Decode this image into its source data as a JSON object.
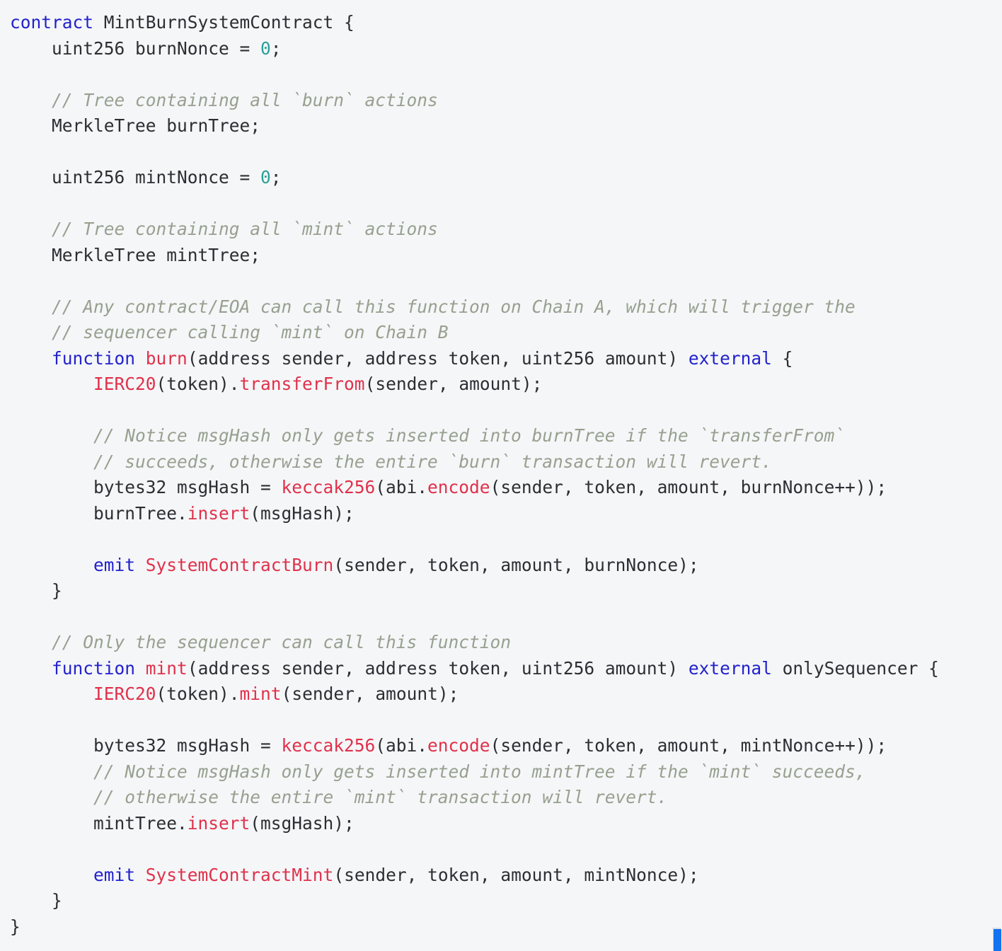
{
  "editor": {
    "language": "solidity",
    "background_color": "#f5f6f8",
    "foreground_color": "#2b2f33",
    "theme_colors": {
      "keyword": "#2222cc",
      "function": "#e0314b",
      "number": "#2aa198",
      "comment": "#97a08f",
      "plain": "#2b2f33"
    }
  },
  "scrollbar": {
    "thumb_color": "#1272f0",
    "orientation": "vertical",
    "position": "bottom-right"
  },
  "code": {
    "lines": [
      {
        "id": "l1",
        "tokens": [
          {
            "t": "kw",
            "v": "contract"
          },
          {
            "t": "pl",
            "v": " MintBurnSystemContract {"
          }
        ]
      },
      {
        "id": "l2",
        "tokens": [
          {
            "t": "pl",
            "v": "    uint256 burnNonce = "
          },
          {
            "t": "num",
            "v": "0"
          },
          {
            "t": "pl",
            "v": ";"
          }
        ]
      },
      {
        "id": "l3",
        "tokens": [
          {
            "t": "pl",
            "v": ""
          }
        ]
      },
      {
        "id": "l4",
        "tokens": [
          {
            "t": "cmt",
            "v": "    // Tree containing all `burn` actions"
          }
        ]
      },
      {
        "id": "l5",
        "tokens": [
          {
            "t": "pl",
            "v": "    MerkleTree burnTree;"
          }
        ]
      },
      {
        "id": "l6",
        "tokens": [
          {
            "t": "pl",
            "v": ""
          }
        ]
      },
      {
        "id": "l7",
        "tokens": [
          {
            "t": "pl",
            "v": "    uint256 mintNonce = "
          },
          {
            "t": "num",
            "v": "0"
          },
          {
            "t": "pl",
            "v": ";"
          }
        ]
      },
      {
        "id": "l8",
        "tokens": [
          {
            "t": "pl",
            "v": ""
          }
        ]
      },
      {
        "id": "l9",
        "tokens": [
          {
            "t": "cmt",
            "v": "    // Tree containing all `mint` actions"
          }
        ]
      },
      {
        "id": "l10",
        "tokens": [
          {
            "t": "pl",
            "v": "    MerkleTree mintTree;"
          }
        ]
      },
      {
        "id": "l11",
        "tokens": [
          {
            "t": "pl",
            "v": ""
          }
        ]
      },
      {
        "id": "l12",
        "tokens": [
          {
            "t": "cmt",
            "v": "    // Any contract/EOA can call this function on Chain A, which will trigger the"
          }
        ]
      },
      {
        "id": "l13",
        "tokens": [
          {
            "t": "cmt",
            "v": "    // sequencer calling `mint` on Chain B"
          }
        ]
      },
      {
        "id": "l14",
        "tokens": [
          {
            "t": "pl",
            "v": "    "
          },
          {
            "t": "kw",
            "v": "function"
          },
          {
            "t": "pl",
            "v": " "
          },
          {
            "t": "fn",
            "v": "burn"
          },
          {
            "t": "pl",
            "v": "(address sender, address token, uint256 amount) "
          },
          {
            "t": "kw",
            "v": "external"
          },
          {
            "t": "pl",
            "v": " {"
          }
        ]
      },
      {
        "id": "l15",
        "tokens": [
          {
            "t": "pl",
            "v": "        "
          },
          {
            "t": "fn",
            "v": "IERC20"
          },
          {
            "t": "pl",
            "v": "(token)."
          },
          {
            "t": "fn",
            "v": "transferFrom"
          },
          {
            "t": "pl",
            "v": "(sender, amount);"
          }
        ]
      },
      {
        "id": "l16",
        "tokens": [
          {
            "t": "pl",
            "v": ""
          }
        ]
      },
      {
        "id": "l17",
        "tokens": [
          {
            "t": "cmt",
            "v": "        // Notice msgHash only gets inserted into burnTree if the `transferFrom`"
          }
        ]
      },
      {
        "id": "l18",
        "tokens": [
          {
            "t": "cmt",
            "v": "        // succeeds, otherwise the entire `burn` transaction will revert."
          }
        ]
      },
      {
        "id": "l19",
        "tokens": [
          {
            "t": "pl",
            "v": "        bytes32 msgHash = "
          },
          {
            "t": "fn",
            "v": "keccak256"
          },
          {
            "t": "pl",
            "v": "(abi."
          },
          {
            "t": "fn",
            "v": "encode"
          },
          {
            "t": "pl",
            "v": "(sender, token, amount, burnNonce++));"
          }
        ]
      },
      {
        "id": "l20",
        "tokens": [
          {
            "t": "pl",
            "v": "        burnTree."
          },
          {
            "t": "fn",
            "v": "insert"
          },
          {
            "t": "pl",
            "v": "(msgHash);"
          }
        ]
      },
      {
        "id": "l21",
        "tokens": [
          {
            "t": "pl",
            "v": ""
          }
        ]
      },
      {
        "id": "l22",
        "tokens": [
          {
            "t": "pl",
            "v": "        "
          },
          {
            "t": "kw",
            "v": "emit"
          },
          {
            "t": "pl",
            "v": " "
          },
          {
            "t": "fn",
            "v": "SystemContractBurn"
          },
          {
            "t": "pl",
            "v": "(sender, token, amount, burnNonce);"
          }
        ]
      },
      {
        "id": "l23",
        "tokens": [
          {
            "t": "pl",
            "v": "    }"
          }
        ]
      },
      {
        "id": "l24",
        "tokens": [
          {
            "t": "pl",
            "v": ""
          }
        ]
      },
      {
        "id": "l25",
        "tokens": [
          {
            "t": "cmt",
            "v": "    // Only the sequencer can call this function"
          }
        ]
      },
      {
        "id": "l26",
        "tokens": [
          {
            "t": "pl",
            "v": "    "
          },
          {
            "t": "kw",
            "v": "function"
          },
          {
            "t": "pl",
            "v": " "
          },
          {
            "t": "fn",
            "v": "mint"
          },
          {
            "t": "pl",
            "v": "(address sender, address token, uint256 amount) "
          },
          {
            "t": "kw",
            "v": "external"
          },
          {
            "t": "pl",
            "v": " onlySequencer {"
          }
        ]
      },
      {
        "id": "l27",
        "tokens": [
          {
            "t": "pl",
            "v": "        "
          },
          {
            "t": "fn",
            "v": "IERC20"
          },
          {
            "t": "pl",
            "v": "(token)."
          },
          {
            "t": "fn",
            "v": "mint"
          },
          {
            "t": "pl",
            "v": "(sender, amount);"
          }
        ]
      },
      {
        "id": "l28",
        "tokens": [
          {
            "t": "pl",
            "v": ""
          }
        ]
      },
      {
        "id": "l29",
        "tokens": [
          {
            "t": "pl",
            "v": "        bytes32 msgHash = "
          },
          {
            "t": "fn",
            "v": "keccak256"
          },
          {
            "t": "pl",
            "v": "(abi."
          },
          {
            "t": "fn",
            "v": "encode"
          },
          {
            "t": "pl",
            "v": "(sender, token, amount, mintNonce++));"
          }
        ]
      },
      {
        "id": "l30",
        "tokens": [
          {
            "t": "cmt",
            "v": "        // Notice msgHash only gets inserted into mintTree if the `mint` succeeds,"
          }
        ]
      },
      {
        "id": "l31",
        "tokens": [
          {
            "t": "cmt",
            "v": "        // otherwise the entire `mint` transaction will revert."
          }
        ]
      },
      {
        "id": "l32",
        "tokens": [
          {
            "t": "pl",
            "v": "        mintTree."
          },
          {
            "t": "fn",
            "v": "insert"
          },
          {
            "t": "pl",
            "v": "(msgHash);"
          }
        ]
      },
      {
        "id": "l33",
        "tokens": [
          {
            "t": "pl",
            "v": ""
          }
        ]
      },
      {
        "id": "l34",
        "tokens": [
          {
            "t": "pl",
            "v": "        "
          },
          {
            "t": "kw",
            "v": "emit"
          },
          {
            "t": "pl",
            "v": " "
          },
          {
            "t": "fn",
            "v": "SystemContractMint"
          },
          {
            "t": "pl",
            "v": "(sender, token, amount, mintNonce);"
          }
        ]
      },
      {
        "id": "l35",
        "tokens": [
          {
            "t": "pl",
            "v": "    }"
          }
        ]
      },
      {
        "id": "l36",
        "tokens": [
          {
            "t": "pl",
            "v": "}"
          }
        ]
      }
    ]
  }
}
